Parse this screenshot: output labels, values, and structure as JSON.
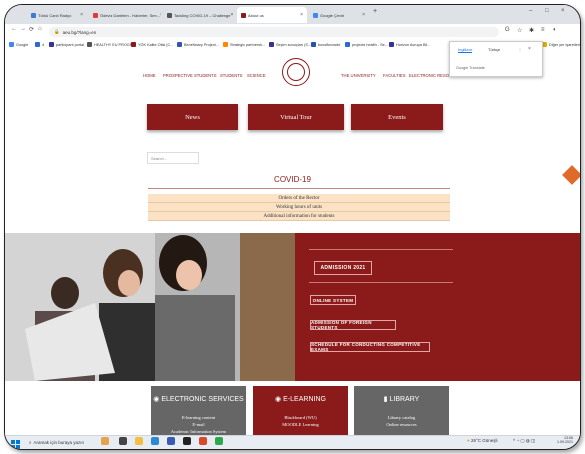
{
  "browser": {
    "tabs": [
      {
        "label": "Türkü Canlı Radyo",
        "color": "#3c7ccf"
      },
      {
        "label": "Ödeviz Darleten - Haberler, Sen...",
        "color": "#e03b3b"
      },
      {
        "label": "Tackling COVID-19 – Challenge",
        "color": "#555555"
      },
      {
        "label": "About us",
        "color": "#8b1a1a"
      },
      {
        "label": "Google Çeviri",
        "color": "#4285f4"
      }
    ],
    "new_tab": "+",
    "window_controls": {
      "minimize": "–",
      "maximize": "□",
      "close": "×"
    },
    "nav": {
      "back": "←",
      "forward": "→",
      "reload": "⟳",
      "home": "⌂"
    },
    "url": "aeu.bg/?lang=en",
    "toolbar_icons": [
      "G",
      "☆",
      "✱",
      "≡",
      "◐"
    ],
    "bookmarks": [
      {
        "label": "Google",
        "color": "#4285f4"
      },
      {
        "label": "4",
        "color": "#2b6acf"
      },
      {
        "label": "participant portal",
        "color": "#333399"
      },
      {
        "label": "HEALTHY EU PROGR...",
        "color": "#555555"
      },
      {
        "label": "YÖK Kalite Ofisi (C...",
        "color": "#8b1a1a"
      },
      {
        "label": "Beneficiary Project...",
        "color": "#3355aa"
      },
      {
        "label": "Strategic partnersh...",
        "color": "#ff8800"
      },
      {
        "label": "Seçim sonuçları (S...",
        "color": "#333399"
      },
      {
        "label": "boxofknowde",
        "color": "#2255aa"
      },
      {
        "label": "projects health - Se...",
        "color": "#2b6acf"
      },
      {
        "label": "Horizon Avrupa Bil...",
        "color": "#333399"
      },
      {
        "label": "Diğer yer işaretleri",
        "color": "#e0b000"
      }
    ],
    "translate_popup": {
      "lang1": "İngilizce",
      "lang2": "Türkçe",
      "brand": "Google Translate",
      "menu": "⋮",
      "close": "×"
    }
  },
  "site": {
    "nav_left": [
      "HOME",
      "PROSPECTIVE STUDENTS",
      "STUDENTS",
      "SCIENCE"
    ],
    "nav_right": [
      "THE UNIVERSITY",
      "FACULTIES",
      "ELECTRONIC RESOURCES"
    ],
    "buttons": [
      "News",
      "Virtual Tour",
      "Events"
    ],
    "search_placeholder": "Search...",
    "covid": {
      "title": "COVID-19",
      "items": [
        "Orders of the Rector",
        "Working hours of units",
        "Additional information for students"
      ]
    },
    "admission": {
      "title": "ADMISSION 2021",
      "links": [
        "ONLINE SYSTEM",
        "ADMISSION OF FOREIGN STUDENTS",
        "SCHEDULE FOR CONDUCTING COMPETITIVE EXAMS"
      ]
    },
    "cards": [
      {
        "title": "ELECTRONIC SERVICES",
        "icon": "◉",
        "lines": [
          "E-learning content",
          "E-mail",
          "Academic Information System"
        ],
        "color": "#666666"
      },
      {
        "title": "E-LEARNING",
        "icon": "◉",
        "lines": [
          "Blackboard (WU)",
          "MOODLE Learning"
        ],
        "color": "#8b1a1a"
      },
      {
        "title": "LIBRARY",
        "icon": "▮",
        "lines": [
          "Library catalog",
          "Online resources"
        ],
        "color": "#666666"
      }
    ]
  },
  "taskbar": {
    "search": "Aramak için buraya yazın",
    "weather": "26°C Güneşli",
    "time": "13:06",
    "date": "1.09.2021"
  }
}
